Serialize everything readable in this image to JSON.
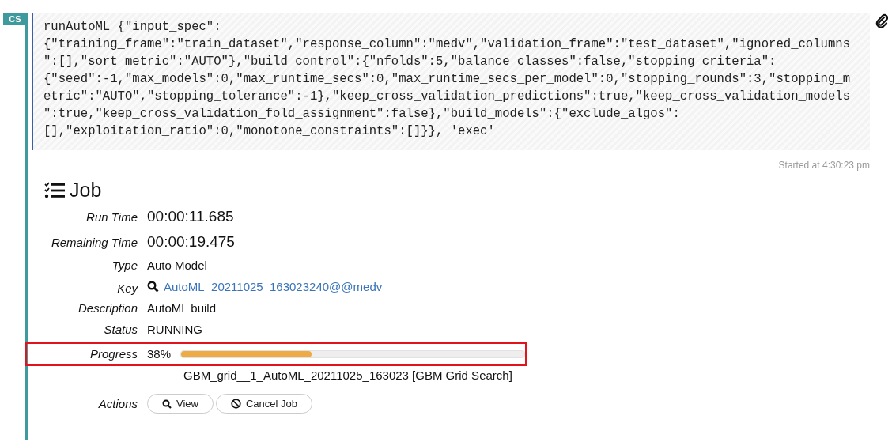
{
  "cell": {
    "badge": "CS",
    "code_lines": [
      "runAutoML {\"input_spec\":",
      "{\"training_frame\":\"train_dataset\",\"response_column\":\"medv\",\"validation_frame\":\"test_dataset\",\"ignored_columns",
      "\":[],\"sort_metric\":\"AUTO\"},\"build_control\":{\"nfolds\":5,\"balance_classes\":false,\"stopping_criteria\":",
      "{\"seed\":-1,\"max_models\":0,\"max_runtime_secs\":0,\"max_runtime_secs_per_model\":0,\"stopping_rounds\":3,\"stopping_m",
      "etric\":\"AUTO\",\"stopping_tolerance\":-1},\"keep_cross_validation_predictions\":true,\"keep_cross_validation_models",
      "\":true,\"keep_cross_validation_fold_assignment\":false},\"build_models\":{\"exclude_algos\":",
      "[],\"exploitation_ratio\":0,\"monotone_constraints\":[]}}, 'exec'"
    ],
    "started": "Started at 4:30:23 pm"
  },
  "job": {
    "title": "Job",
    "fields": [
      {
        "kind": "large",
        "label": "Run Time",
        "value": "00:00:11.685"
      },
      {
        "kind": "large",
        "label": "Remaining Time",
        "value": "00:00:19.475"
      },
      {
        "kind": "text",
        "label": "Type",
        "value": "Auto Model"
      },
      {
        "kind": "link",
        "label": "Key",
        "value": "AutoML_20211025_163023240@@medv"
      },
      {
        "kind": "text",
        "label": "Description",
        "value": "AutoML build"
      },
      {
        "kind": "text",
        "label": "Status",
        "value": "RUNNING"
      },
      {
        "kind": "progress",
        "label": "Progress",
        "value": "38%",
        "level": 0.38,
        "highlighted": true
      },
      {
        "kind": "note",
        "value": "GBM_grid__1_AutoML_20211025_163023 [GBM Grid Search]"
      }
    ],
    "actions_label": "Actions",
    "actions": [
      {
        "kind": "view",
        "label": "View"
      },
      {
        "kind": "cancel",
        "label": "Cancel Job"
      }
    ]
  }
}
